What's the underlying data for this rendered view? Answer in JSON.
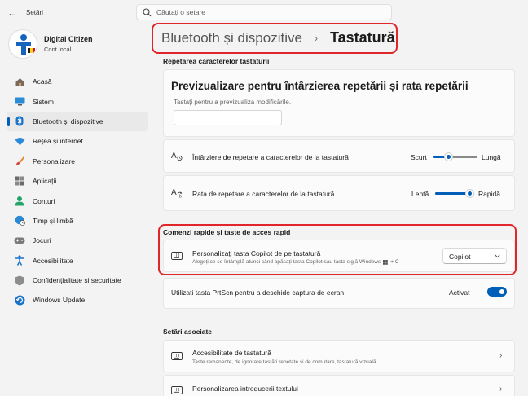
{
  "app": {
    "title": "Setări"
  },
  "search": {
    "placeholder": "Căutați o setare"
  },
  "user": {
    "name": "Digital Citizen",
    "account": "Cont local"
  },
  "sidebar": {
    "items": [
      {
        "label": "Acasă",
        "icon": "home-icon"
      },
      {
        "label": "Sistem",
        "icon": "monitor-icon"
      },
      {
        "label": "Bluetooth și dispozitive",
        "icon": "bluetooth-icon",
        "active": true
      },
      {
        "label": "Rețea și internet",
        "icon": "wifi-icon"
      },
      {
        "label": "Personalizare",
        "icon": "brush-icon"
      },
      {
        "label": "Aplicații",
        "icon": "apps-icon"
      },
      {
        "label": "Conturi",
        "icon": "person-icon"
      },
      {
        "label": "Timp și limbă",
        "icon": "globe-clock-icon"
      },
      {
        "label": "Jocuri",
        "icon": "gamepad-icon"
      },
      {
        "label": "Accesibilitate",
        "icon": "accessibility-icon"
      },
      {
        "label": "Confidențialitate și securitate",
        "icon": "shield-icon"
      },
      {
        "label": "Windows Update",
        "icon": "update-icon"
      }
    ]
  },
  "breadcrumb": {
    "parent": "Bluetooth și dispozitive",
    "separator": "›",
    "current": "Tastatură"
  },
  "repeat": {
    "section_title": "Repetarea caracterelor tastaturii",
    "preview_title": "Previzualizare pentru întârzierea repetării și rata repetării",
    "preview_hint": "Tastați pentru a previzualiza modificările.",
    "delay": {
      "label": "Întârziere de repetare a caracterelor de la tastatură",
      "min_label": "Scurt",
      "max_label": "Lungă",
      "value": 0.3
    },
    "rate": {
      "label": "Rata de repetare a caracterelor de la tastatură",
      "min_label": "Lentă",
      "max_label": "Rapidă",
      "value": 1.0
    }
  },
  "shortcuts": {
    "section_title": "Comenzi rapide și taste de acces rapid",
    "copilot": {
      "label": "Personalizați tasta Copilot de pe tastatură",
      "description": "Alegeți ce se întâmplă atunci când apăsați tasta Copilot sau tasta siglă Windows",
      "description_suffix": "+ C",
      "value": "Copilot"
    },
    "prtscn": {
      "label": "Utilizați tasta PrtScn pentru a deschide captura de ecran",
      "state_label": "Activat"
    }
  },
  "related": {
    "section_title": "Setări asociate",
    "items": [
      {
        "label": "Accesibilitate de tastatură",
        "description": "Taste remanente, de ignorare tastări repetate și de comutare, tastatură vizuală"
      },
      {
        "label": "Personalizarea introducerii textului"
      }
    ]
  }
}
